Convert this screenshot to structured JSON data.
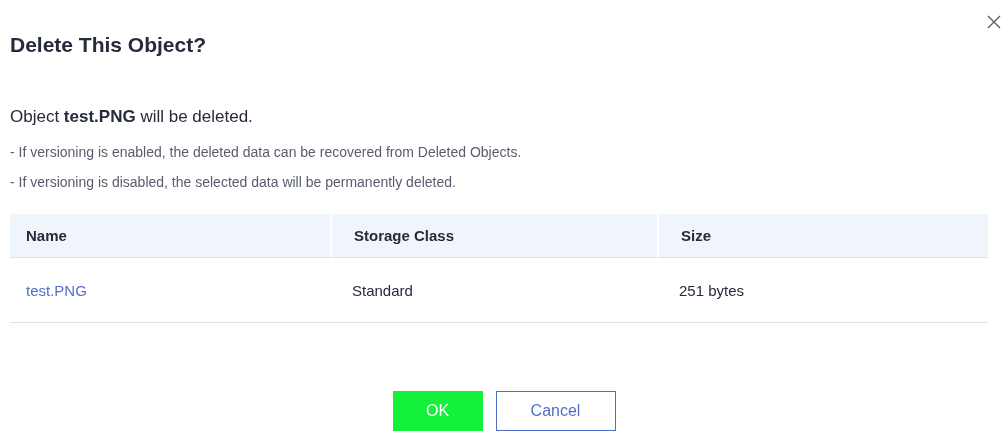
{
  "dialog": {
    "title": "Delete This Object?",
    "message": "Object **test.PNG** will be deleted.",
    "notes": [
      "- If versioning is enabled, the deleted data can be recovered from Deleted Objects.",
      "- If versioning is disabled, the selected data will be permanently deleted."
    ],
    "table": {
      "columns": [
        "Name",
        "Storage Class",
        "Size"
      ],
      "rows": [
        {
          "name": "test.PNG",
          "storage_class": "Standard",
          "size": "251 bytes"
        }
      ]
    },
    "buttons": [
      {
        "kind": "primary",
        "label": "OK"
      },
      {
        "kind": "secondary",
        "label": "Cancel"
      }
    ]
  }
}
